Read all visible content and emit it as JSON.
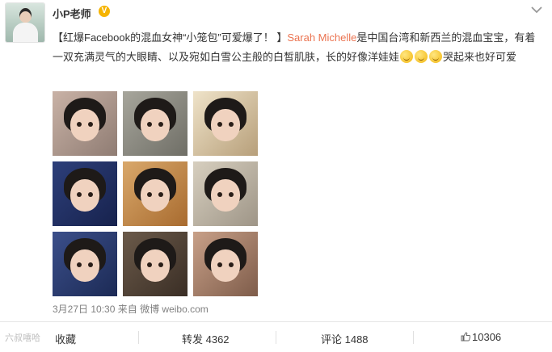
{
  "post": {
    "username": "小P老师",
    "verified_badge": "V",
    "text_prefix": "【红爆Facebook的混血女神“小笼包”可爱爆了！ 】",
    "highlight_name": "Sarah Michelle",
    "text_main": "是中国台湾和新西兰的混血宝宝，有着一双充满灵气的大眼睛、以及宛如白雪公主般的白皙肌肤，长的好像洋娃娃",
    "text_suffix": "哭起来也好可爱",
    "emoji_count": 3,
    "timestamp": "3月27日 10:30",
    "source_prefix": "来自",
    "source": "微博 weibo.com"
  },
  "actions": {
    "favorite_label": "收藏",
    "repost_label": "转发 4362",
    "comment_label": "评论 1488",
    "like_count": "10306"
  },
  "watermark": "六叔嘻哈",
  "icons": [
    "chevron-down-icon",
    "verified-v-icon",
    "like-thumb-icon",
    "emoji-icon"
  ],
  "colors": {
    "highlight": "#eb7350",
    "text": "#333333",
    "meta": "#808080",
    "verified": "#f6b400"
  }
}
